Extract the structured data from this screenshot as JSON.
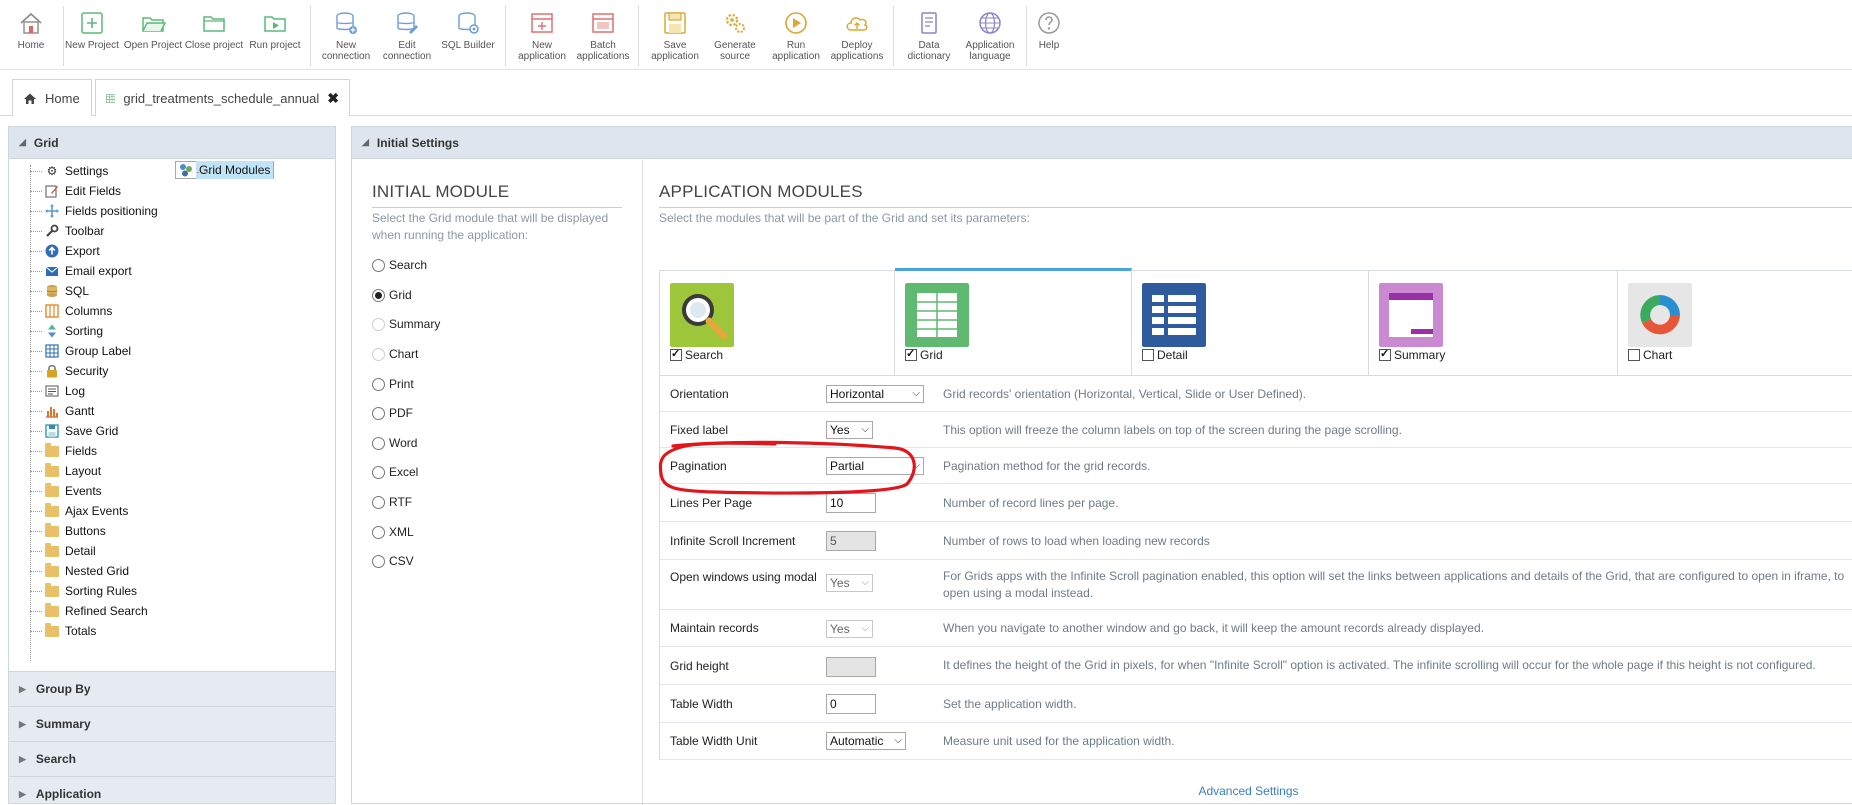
{
  "toolbar": {
    "buttons": [
      {
        "label": "Home",
        "icon": "home-icon"
      },
      {
        "label": "New Project",
        "icon": "new-project-icon"
      },
      {
        "label": "Open Project",
        "icon": "open-project-icon"
      },
      {
        "label": "Close project",
        "icon": "close-project-icon"
      },
      {
        "label": "Run project",
        "icon": "run-project-icon"
      },
      {
        "label": "New connection",
        "icon": "new-connection-icon"
      },
      {
        "label": "Edit connection",
        "icon": "edit-connection-icon"
      },
      {
        "label": "SQL Builder",
        "icon": "sql-builder-icon"
      },
      {
        "label": "New application",
        "icon": "new-application-icon"
      },
      {
        "label": "Batch applications",
        "icon": "batch-applications-icon"
      },
      {
        "label": "Save application",
        "icon": "save-application-icon"
      },
      {
        "label": "Generate source",
        "icon": "generate-source-icon"
      },
      {
        "label": "Run application",
        "icon": "run-application-icon"
      },
      {
        "label": "Deploy applications",
        "icon": "deploy-applications-icon"
      },
      {
        "label": "Data dictionary",
        "icon": "data-dictionary-icon"
      },
      {
        "label": "Application language",
        "icon": "application-language-icon"
      },
      {
        "label": "Help",
        "icon": "help-icon"
      }
    ]
  },
  "tabs": [
    {
      "label": "Home",
      "icon": "home-icon"
    },
    {
      "label": "grid_treatments_schedule_annual",
      "icon": "grid-icon",
      "close": "✖"
    }
  ],
  "sidebar": {
    "title": "Grid",
    "items": [
      {
        "label": "Grid Modules",
        "icon": "grid-modules-icon"
      },
      {
        "label": "Settings",
        "icon": "gear-icon"
      },
      {
        "label": "Edit Fields",
        "icon": "edit-fields-icon"
      },
      {
        "label": "Fields positioning",
        "icon": "move-icon"
      },
      {
        "label": "Toolbar",
        "icon": "wrench-icon"
      },
      {
        "label": "Export",
        "icon": "export-icon"
      },
      {
        "label": "Email export",
        "icon": "email-icon"
      },
      {
        "label": "SQL",
        "icon": "database-icon"
      },
      {
        "label": "Columns",
        "icon": "columns-icon"
      },
      {
        "label": "Sorting",
        "icon": "sorting-icon"
      },
      {
        "label": "Group Label",
        "icon": "table-icon"
      },
      {
        "label": "Security",
        "icon": "lock-icon"
      },
      {
        "label": "Log",
        "icon": "log-icon"
      },
      {
        "label": "Gantt",
        "icon": "gantt-icon"
      },
      {
        "label": "Save Grid",
        "icon": "save-icon"
      },
      {
        "label": "Fields",
        "icon": "folder-icon"
      },
      {
        "label": "Layout",
        "icon": "folder-icon"
      },
      {
        "label": "Events",
        "icon": "folder-icon"
      },
      {
        "label": "Ajax Events",
        "icon": "folder-icon"
      },
      {
        "label": "Buttons",
        "icon": "folder-icon"
      },
      {
        "label": "Detail",
        "icon": "folder-icon"
      },
      {
        "label": "Nested Grid",
        "icon": "folder-icon"
      },
      {
        "label": "Sorting Rules",
        "icon": "folder-icon"
      },
      {
        "label": "Refined Search",
        "icon": "folder-icon"
      },
      {
        "label": "Totals",
        "icon": "folder-icon"
      }
    ],
    "groups": [
      "Group By",
      "Summary",
      "Search",
      "Application"
    ]
  },
  "main": {
    "header": "Initial Settings",
    "initial": {
      "title": "INITIAL MODULE",
      "description": "Select the Grid module that will be displayed when running the application:",
      "options": [
        {
          "label": "Search",
          "state": "off"
        },
        {
          "label": "Grid",
          "state": "on"
        },
        {
          "label": "Summary",
          "state": "disabled"
        },
        {
          "label": "Chart",
          "state": "disabled"
        },
        {
          "label": "Print",
          "state": "off"
        },
        {
          "label": "PDF",
          "state": "off"
        },
        {
          "label": "Word",
          "state": "off"
        },
        {
          "label": "Excel",
          "state": "off"
        },
        {
          "label": "RTF",
          "state": "off"
        },
        {
          "label": "XML",
          "state": "off"
        },
        {
          "label": "CSV",
          "state": "off"
        }
      ]
    },
    "modules": {
      "title": "APPLICATION MODULES",
      "description": "Select the modules that will be part of the Grid and set its parameters:",
      "tabs": [
        {
          "label": "Search",
          "checked": true,
          "icon": "search-module-icon"
        },
        {
          "label": "Grid",
          "checked": true,
          "icon": "grid-module-icon"
        },
        {
          "label": "Detail",
          "checked": false,
          "icon": "detail-module-icon"
        },
        {
          "label": "Summary",
          "checked": true,
          "icon": "summary-module-icon"
        },
        {
          "label": "Chart",
          "checked": false,
          "icon": "chart-module-icon"
        }
      ]
    },
    "properties": [
      {
        "label": "Orientation",
        "type": "select",
        "value": "Horizontal",
        "help": "Grid records' orientation (Horizontal, Vertical, Slide or User Defined)."
      },
      {
        "label": "Fixed label",
        "type": "select",
        "value": "Yes",
        "help": "This option will freeze the column labels on top of the screen during the page scrolling."
      },
      {
        "label": "Pagination",
        "type": "select",
        "value": "Partial",
        "help": "Pagination method for the grid records."
      },
      {
        "label": "Lines Per Page",
        "type": "text",
        "value": "10",
        "help": "Number of record lines per page."
      },
      {
        "label": "Infinite Scroll Increment",
        "type": "text-disabled",
        "value": "5",
        "help": "Number of rows to load when loading new records"
      },
      {
        "label": "Open windows using modal",
        "type": "select-disabled",
        "value": "Yes",
        "help": "For Grids apps with the Infinite Scroll pagination enabled, this option will set the links between applications and details of the Grid, that are configured to open in iframe, to open using a modal instead."
      },
      {
        "label": "Maintain records",
        "type": "select-disabled",
        "value": "Yes",
        "help": "When you navigate to another window and go back, it will keep the amount records already displayed."
      },
      {
        "label": "Grid height",
        "type": "text-disabled",
        "value": "",
        "help": "It defines the height of the Grid in pixels, for when \"Infinite Scroll\" option is activated. The infinite scrolling will occur for the whole page if this height is not configured."
      },
      {
        "label": "Table Width",
        "type": "text",
        "value": "0",
        "help": "Set the application width."
      },
      {
        "label": "Table Width Unit",
        "type": "select",
        "value": "Automatic",
        "help": "Measure unit used for the application width."
      }
    ],
    "advanced_link": "Advanced Settings"
  },
  "colors": {
    "highlight_annotation": "#e0161c",
    "active_tab_accent": "#4aa3df",
    "panel_header": "#dde6ee",
    "link": "#3a7fc1"
  }
}
